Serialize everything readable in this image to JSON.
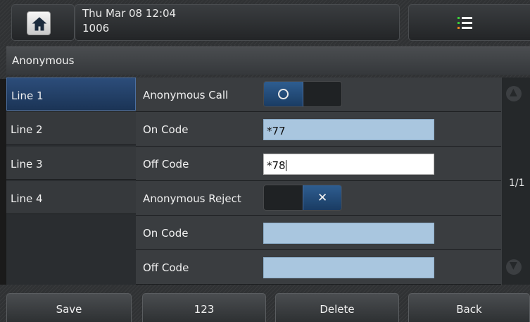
{
  "status_bar": {
    "date_time": "Thu Mar 08 12:04",
    "extension": "1006",
    "home_icon": "home-icon",
    "menu_icon": "menu-list-icon"
  },
  "page": {
    "title": "Anonymous",
    "pagination": "1/1"
  },
  "lines": [
    {
      "label": "Line 1",
      "selected": true
    },
    {
      "label": "Line 2",
      "selected": false
    },
    {
      "label": "Line 3",
      "selected": false
    },
    {
      "label": "Line 4",
      "selected": false
    }
  ],
  "settings": {
    "anonymous_call": {
      "label": "Anonymous Call",
      "state": "on"
    },
    "call_on_code": {
      "label": "On Code",
      "value": "*77"
    },
    "call_off_code": {
      "label": "Off Code",
      "value": "*78"
    },
    "anonymous_reject": {
      "label": "Anonymous Reject",
      "state": "off"
    },
    "reject_on_code": {
      "label": "On Code",
      "value": ""
    },
    "reject_off_code": {
      "label": "Off Code",
      "value": ""
    }
  },
  "softkeys": {
    "save": "Save",
    "ime": "123",
    "delete": "Delete",
    "back": "Back"
  },
  "colors": {
    "accent_blue": "#2e5d90",
    "field_blue": "#a9c6df",
    "menu_green": "#3bd13b",
    "menu_orange": "#f08a1c"
  }
}
